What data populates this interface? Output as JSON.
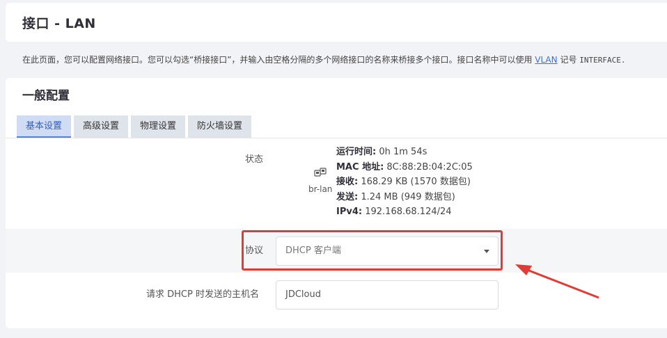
{
  "header": {
    "title": "接口 - LAN"
  },
  "description": {
    "text_before_link": "在此页面，您可以配置网络接口。您可以勾选“桥接接口”，并输入由空格分隔的多个网络接口的名称来桥接多个接口。接口名称中可以使用 ",
    "link_text": "VLAN",
    "text_middle": " 记号 ",
    "code_text": "INTERFACE."
  },
  "section": {
    "title": "一般配置",
    "tabs": [
      {
        "label": "基本设置",
        "active": true
      },
      {
        "label": "高级设置",
        "active": false
      },
      {
        "label": "物理设置",
        "active": false
      },
      {
        "label": "防火墙设置",
        "active": false
      }
    ]
  },
  "status": {
    "label": "状态",
    "interface_name": "br-lan",
    "icon": "ethernet-bridge-icon",
    "items": [
      {
        "key": "运行时间:",
        "value": "0h 1m 54s"
      },
      {
        "key": "MAC 地址:",
        "value": "8C:88:2B:04:2C:05"
      },
      {
        "key": "接收:",
        "value": "168.29 KB (1570 数据包)"
      },
      {
        "key": "发送:",
        "value": "1.24 MB (949 数据包)"
      },
      {
        "key": "IPv4:",
        "value": "192.168.68.124/24"
      }
    ]
  },
  "protocol": {
    "label": "协议",
    "selected": "DHCP 客户端"
  },
  "hostname": {
    "label": "请求 DHCP 时发送的主机名",
    "value": "JDCloud"
  },
  "colors": {
    "highlight_box": "#e23b35",
    "accent_tab": "#3a5fb3"
  }
}
